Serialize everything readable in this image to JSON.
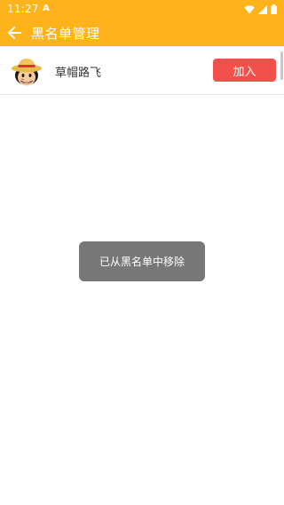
{
  "status_bar": {
    "time": "11:27",
    "notification_glyph": "A",
    "icons": [
      "wifi-icon",
      "signal-icon",
      "battery-icon"
    ]
  },
  "app_bar": {
    "title": "黑名单管理",
    "back_icon": "arrow-left-icon"
  },
  "blacklist": {
    "items": [
      {
        "name": "草帽路飞",
        "avatar": "straw-hat-avatar",
        "action_label": "加入"
      }
    ]
  },
  "toast": {
    "message": "已从黑名单中移除"
  },
  "colors": {
    "primary": "#FFB31A",
    "action_button": "#F2504B",
    "toast_background": "#646464",
    "text_primary": "#333333"
  }
}
